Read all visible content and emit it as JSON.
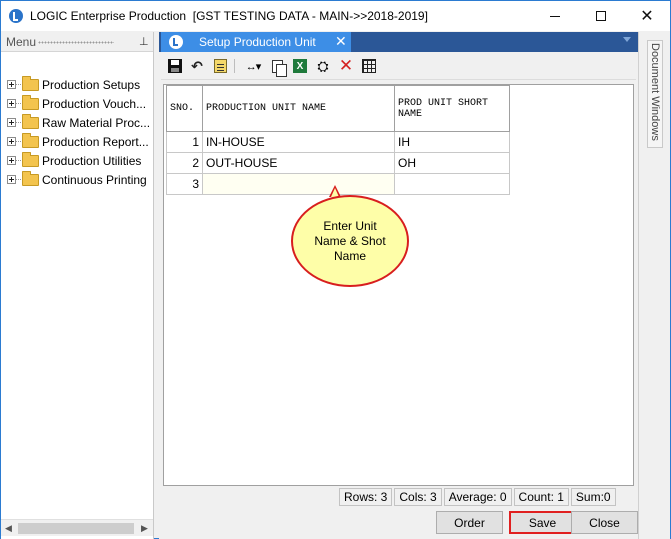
{
  "window": {
    "title": "LOGIC Enterprise Production  [GST TESTING DATA - MAIN->>2018-2019]"
  },
  "menu": {
    "header": "Menu",
    "items": [
      {
        "label": "Production Setups"
      },
      {
        "label": "Production Vouch..."
      },
      {
        "label": "Raw Material Proc..."
      },
      {
        "label": "Production  Report..."
      },
      {
        "label": "Production Utilities"
      },
      {
        "label": "Continuous Printing"
      }
    ]
  },
  "document_tab": {
    "label": "Setup Production Unit",
    "close": "✕"
  },
  "grid": {
    "columns": [
      "SNO.",
      "PRODUCTION UNIT NAME",
      "PROD UNIT SHORT NAME"
    ],
    "rows": [
      {
        "sno": "1",
        "name": "IN-HOUSE",
        "short": "IH"
      },
      {
        "sno": "2",
        "name": "OUT-HOUSE",
        "short": "OH"
      },
      {
        "sno": "3",
        "name": "",
        "short": ""
      }
    ]
  },
  "callout": {
    "text": "Enter Unit Name & Shot Name"
  },
  "status": {
    "rows": "Rows: 3",
    "cols": "Cols: 3",
    "average": "Average: 0",
    "count": "Count: 1",
    "sum": "Sum:0"
  },
  "buttons": {
    "order": "Order",
    "save": "Save",
    "close": "Close"
  },
  "side_panel": {
    "label": "Document Windows"
  },
  "colors": {
    "tab_active": "#3d8ee6",
    "tabstrip": "#2b5797",
    "callout_fill": "#fefea8",
    "highlight_red": "#e02020"
  },
  "icons": [
    "app-logo-icon",
    "pin-icon",
    "folder-icon",
    "save-icon",
    "undo-icon",
    "notes-icon",
    "column-width-icon",
    "copy-icon",
    "excel-icon",
    "find-icon",
    "delete-icon",
    "grid-icon"
  ]
}
